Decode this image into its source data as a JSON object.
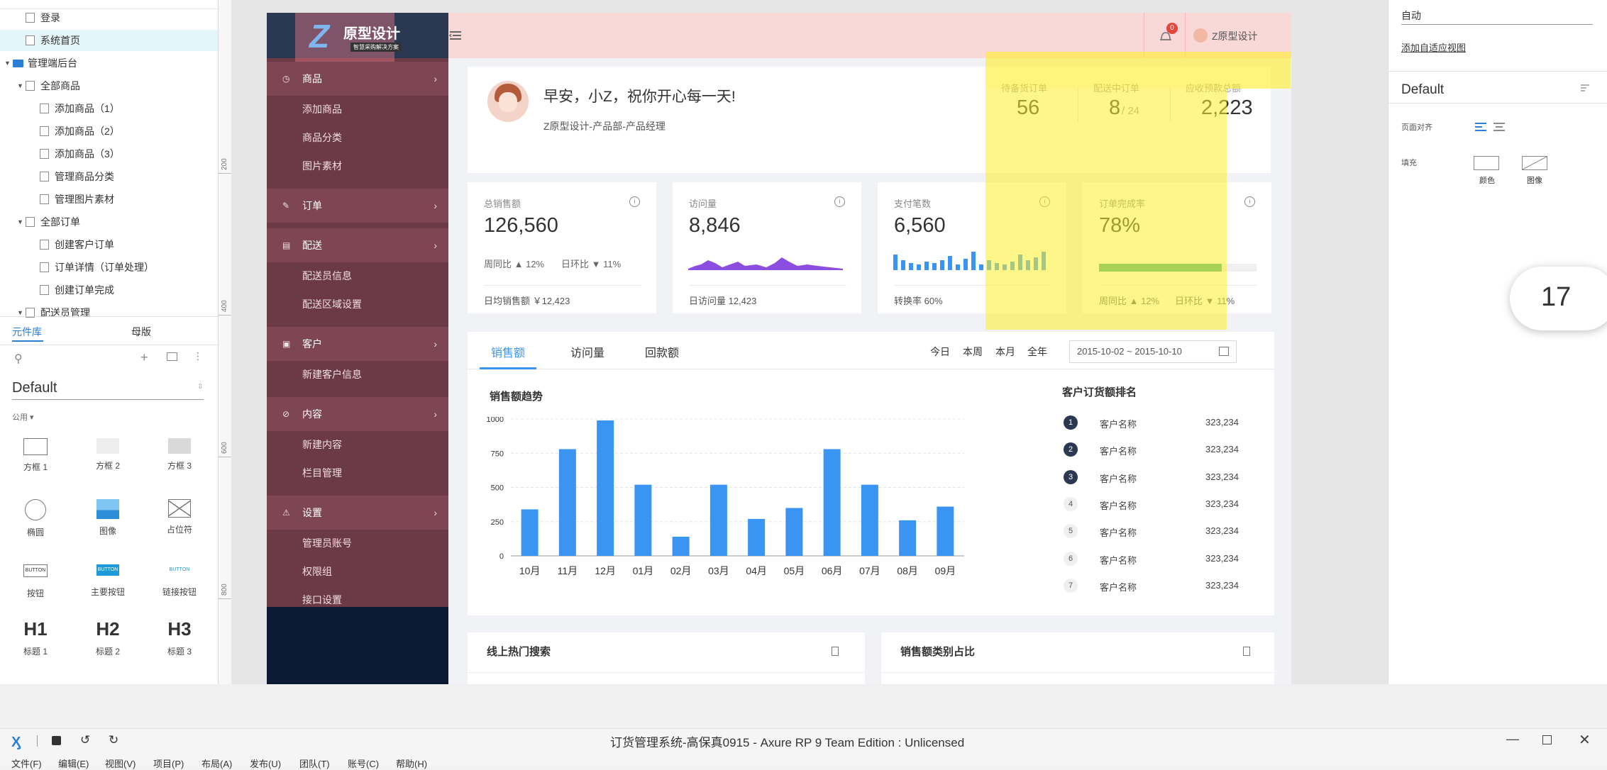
{
  "left_panel": {
    "pages": [
      {
        "label": "登录",
        "level": 1,
        "type": "page"
      },
      {
        "label": "系统首页",
        "level": 1,
        "type": "page",
        "selected": true
      },
      {
        "label": "管理端后台",
        "level": 0,
        "type": "folder"
      },
      {
        "label": "全部商品",
        "level": 1,
        "type": "page",
        "expandable": true
      },
      {
        "label": "添加商品（1）",
        "level": 2,
        "type": "page"
      },
      {
        "label": "添加商品（2）",
        "level": 2,
        "type": "page"
      },
      {
        "label": "添加商品（3）",
        "level": 2,
        "type": "page"
      },
      {
        "label": "管理商品分类",
        "level": 2,
        "type": "page"
      },
      {
        "label": "管理图片素材",
        "level": 2,
        "type": "page"
      },
      {
        "label": "全部订单",
        "level": 1,
        "type": "page",
        "expandable": true
      },
      {
        "label": "创建客户订单",
        "level": 2,
        "type": "page"
      },
      {
        "label": "订单详情（订单处理）",
        "level": 2,
        "type": "page"
      },
      {
        "label": "创建订单完成",
        "level": 2,
        "type": "page"
      },
      {
        "label": "配送员管理",
        "level": 1,
        "type": "page",
        "expandable": true
      }
    ],
    "tabs": [
      "元件库",
      "母版"
    ],
    "library_name": "Default",
    "category": "公用 ▾",
    "components": [
      {
        "label": "方框 1"
      },
      {
        "label": "方框 2"
      },
      {
        "label": "方框 3"
      },
      {
        "label": "椭圆"
      },
      {
        "label": "图像"
      },
      {
        "label": "占位符"
      },
      {
        "label": "按钮",
        "glyph": "BUTTON"
      },
      {
        "label": "主要按钮",
        "glyph": "BUTTON"
      },
      {
        "label": "链接按钮",
        "glyph": "BUTTON"
      },
      {
        "label": "标题 1",
        "glyph": "H1"
      },
      {
        "label": "标题 2",
        "glyph": "H2"
      },
      {
        "label": "标题 3",
        "glyph": "H3"
      }
    ]
  },
  "ruler": {
    "ticks": [
      "200",
      "400",
      "600",
      "800"
    ]
  },
  "app": {
    "logo_title": "原型设计",
    "logo_sub": "智慧采购解决方案",
    "notification_count": "0",
    "user_name": "Z原型设计",
    "sidebar": [
      {
        "label": "商品",
        "icon": "◷",
        "subs": [
          "添加商品",
          "商品分类",
          "图片素材"
        ]
      },
      {
        "label": "订单",
        "icon": "✎",
        "subs": []
      },
      {
        "label": "配送",
        "icon": "▤",
        "subs": [
          "配送员信息",
          "配送区域设置"
        ]
      },
      {
        "label": "客户",
        "icon": "▣",
        "subs": [
          "新建客户信息"
        ]
      },
      {
        "label": "内容",
        "icon": "⊘",
        "subs": [
          "新建内容",
          "栏目管理"
        ]
      },
      {
        "label": "设置",
        "icon": "⚠",
        "subs": [
          "管理员账号",
          "权限组",
          "接口设置"
        ]
      }
    ],
    "welcome": {
      "greeting": "早安，小Z，祝你开心每一天!",
      "subtitle": "Z原型设计-产品部-产品经理",
      "stats": [
        {
          "label": "待备货订单",
          "value": "56",
          "suffix": ""
        },
        {
          "label": "配送中订单",
          "value": "8",
          "suffix": "/ 24"
        },
        {
          "label": "应收预款总额",
          "value": "2,223",
          "suffix": ""
        }
      ]
    },
    "kpis": [
      {
        "label": "总销售额",
        "value": "126,560",
        "row1": [
          "周同比 ▲ 12%",
          "日环比 ▼ 11%"
        ],
        "footer": "日均销售额  ￥12,423"
      },
      {
        "label": "访问量",
        "value": "8,846",
        "footer": "日访问量  12,423"
      },
      {
        "label": "支付笔数",
        "value": "6,560",
        "footer": "转换率  60%"
      },
      {
        "label": "订单完成率",
        "value": "78%",
        "progress": 0.78,
        "footer_a": "周同比 ▲ 12%",
        "footer_b": "日环比 ▼ 11%"
      }
    ],
    "sales_tabs": [
      "销售额",
      "访问量",
      "回款额"
    ],
    "range_buttons": [
      "今日",
      "本周",
      "本月",
      "全年"
    ],
    "date_range": "2015-10-02  ~  2015-10-10",
    "ranking": {
      "title": "客户订货额排名",
      "items": [
        {
          "rank": "1",
          "name": "客户名称",
          "value": "323,234"
        },
        {
          "rank": "2",
          "name": "客户名称",
          "value": "323,234"
        },
        {
          "rank": "3",
          "name": "客户名称",
          "value": "323,234"
        },
        {
          "rank": "4",
          "name": "客户名称",
          "value": "323,234"
        },
        {
          "rank": "5",
          "name": "客户名称",
          "value": "323,234"
        },
        {
          "rank": "6",
          "name": "客户名称",
          "value": "323,234"
        },
        {
          "rank": "7",
          "name": "客户名称",
          "value": "323,234"
        }
      ]
    },
    "bottom_cards": [
      "线上热门搜索",
      "销售额类别占比"
    ]
  },
  "chart_data": {
    "type": "bar",
    "title": "销售额趋势",
    "categories": [
      "10月",
      "11月",
      "12月",
      "01月",
      "02月",
      "03月",
      "04月",
      "05月",
      "06月",
      "07月",
      "08月",
      "09月"
    ],
    "values": [
      340,
      780,
      990,
      520,
      140,
      520,
      270,
      350,
      780,
      520,
      260,
      360
    ],
    "ylim": [
      0,
      1000
    ],
    "yticks": [
      "0",
      "250",
      "500",
      "750",
      "1000"
    ],
    "grid": true,
    "color": "#3a95f2"
  },
  "right_panel": {
    "top_value": "自动",
    "link": "添加自适应视图",
    "style_name": "Default",
    "align_label": "页面对齐",
    "fill_label": "填充",
    "fill_options": [
      "颜色",
      "图像"
    ]
  },
  "badge_number": "17",
  "window": {
    "title": "订货管理系统-高保真0915 - Axure RP 9 Team Edition : Unlicensed",
    "menus": [
      "文件(F)",
      "编辑(E)",
      "视图(V)",
      "项目(P)",
      "布局(A)",
      "发布(U)",
      "团队(T)",
      "账号(C)",
      "帮助(H)"
    ]
  },
  "colors": {
    "sidebar": "#6c3a47",
    "sidebar_head": "#7e4652",
    "accent": "#3a95f2",
    "highlight_yellow": "#ffee28",
    "topbar_pink": "#f9d8d8"
  }
}
